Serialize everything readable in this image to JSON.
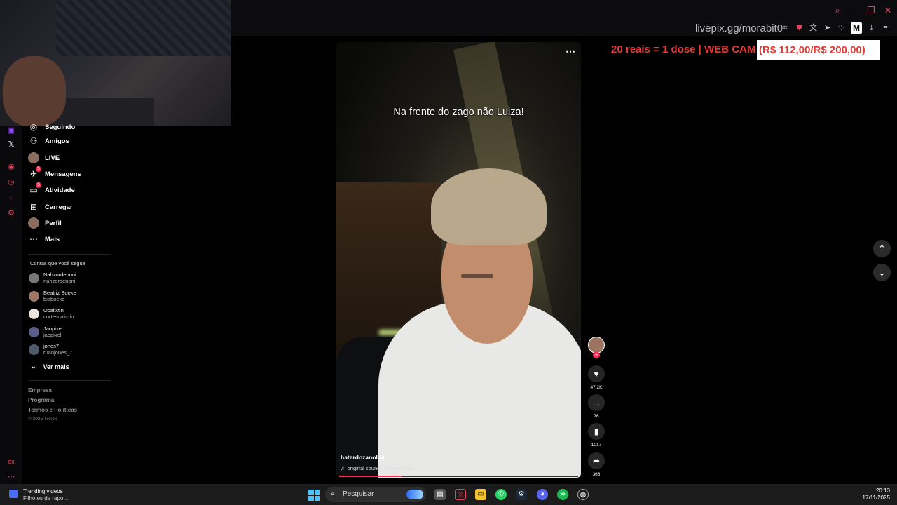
{
  "overlay": {
    "livepix": "livepix.gg/morabit0",
    "promo_text": "20 reais = 1 dose | WEB CAM NOVA",
    "promo_box": "(R$ 112,00/R$ 200,00)"
  },
  "sidebar": {
    "items": [
      {
        "label": "Seguindo",
        "icon": "following-icon"
      },
      {
        "label": "Amigos",
        "icon": "friends-icon"
      },
      {
        "label": "LIVE",
        "icon": "live-icon"
      },
      {
        "label": "Mensagens",
        "icon": "messages-icon",
        "badge": "5"
      },
      {
        "label": "Atividade",
        "icon": "activity-icon",
        "badge": "5"
      },
      {
        "label": "Carregar",
        "icon": "upload-icon"
      },
      {
        "label": "Perfil",
        "icon": "profile-avatar"
      },
      {
        "label": "Mais",
        "icon": "more-icon"
      }
    ],
    "following_title": "Contas que você segue",
    "accounts": [
      {
        "name": "Nahzordenoni",
        "user": "nahzordenoni"
      },
      {
        "name": "Beatriz Boeke",
        "user": "biaboeke"
      },
      {
        "name": "Ocalixtin",
        "user": "cortescalixtin"
      },
      {
        "name": "Jaopixel",
        "user": "jaopixel"
      },
      {
        "name": "jones7",
        "user": "ruanjones_7"
      }
    ],
    "see_more": "Ver mais",
    "footer": [
      "Empresa",
      "Programa",
      "Termos e Políticas"
    ],
    "copyright": "© 2025 TikTok"
  },
  "video": {
    "caption": "Na frente do zago não Luiza!",
    "username": "haterdozanolini",
    "sound": "original sound - Lxuissoundz",
    "progress": 0.26,
    "likes": "47.2K",
    "comments": "76",
    "saves": "1017",
    "shares": "366"
  },
  "taskbar": {
    "widget_title": "Trending videos",
    "widget_sub": "Filhotes de rapo...",
    "search_placeholder": "Pesquisar",
    "time": "20:13",
    "date": "17/11/2025"
  },
  "colors": {
    "accent": "#fe2c55",
    "promo": "#e53935",
    "taskbar": "#1c1c1c"
  }
}
